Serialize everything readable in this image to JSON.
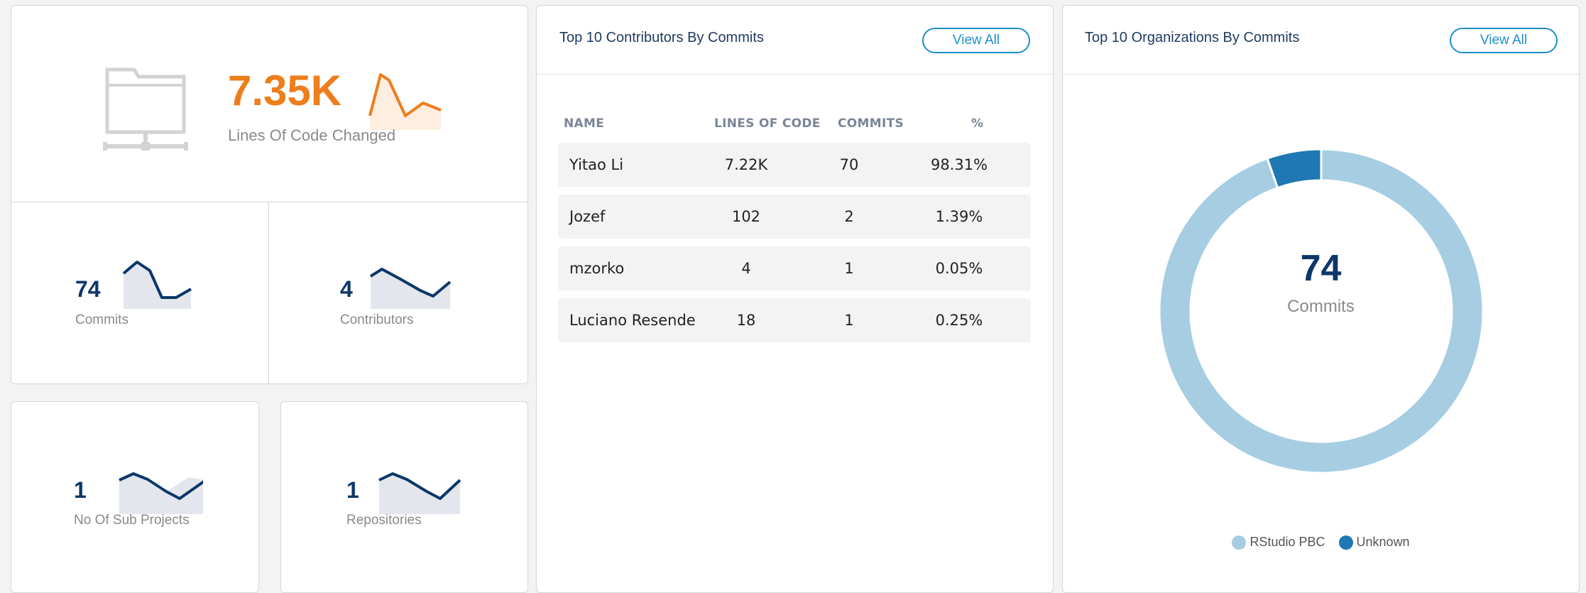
{
  "colors": {
    "orange": "#ee7d1b",
    "navy": "#0b3769",
    "light_blue": "#a6cde2",
    "dark_blue": "#1f77b4",
    "accent": "#1a90c9"
  },
  "lines_changed": {
    "value": "7.35K",
    "label": "Lines Of Code Changed",
    "icon": "folder-network-icon"
  },
  "commits_card": {
    "value": "74",
    "label": "Commits"
  },
  "contributors_card": {
    "value": "4",
    "label": "Contributors"
  },
  "subprojects_card": {
    "value": "1",
    "label": "No Of Sub Projects"
  },
  "repositories_card": {
    "value": "1",
    "label": "Repositories"
  },
  "contributors_table": {
    "title": "Top 10 Contributors By Commits",
    "view_all": "View All",
    "headers": {
      "name": "NAME",
      "loc": "LINES OF CODE",
      "commits": "COMMITS",
      "pct": "%"
    },
    "rows": [
      {
        "name": "Yitao Li",
        "loc": "7.22K",
        "commits": "70",
        "pct": "98.31%"
      },
      {
        "name": "Jozef",
        "loc": "102",
        "commits": "2",
        "pct": "1.39%"
      },
      {
        "name": "mzorko",
        "loc": "4",
        "commits": "1",
        "pct": "0.05%"
      },
      {
        "name": "Luciano Resende",
        "loc": "18",
        "commits": "1",
        "pct": "0.25%"
      }
    ]
  },
  "orgs_panel": {
    "title": "Top 10 Organizations By Commits",
    "view_all": "View All",
    "center_value": "74",
    "center_label": "Commits",
    "legend": [
      {
        "label": "RStudio PBC",
        "color": "#a6cde2"
      },
      {
        "label": "Unknown",
        "color": "#1f77b4"
      }
    ]
  },
  "chart_data": {
    "type": "pie",
    "categories": [
      "RStudio PBC",
      "Unknown"
    ],
    "values": [
      70,
      4
    ],
    "center_text": "74",
    "center_label": "Commits",
    "legend_position": "bottom"
  }
}
